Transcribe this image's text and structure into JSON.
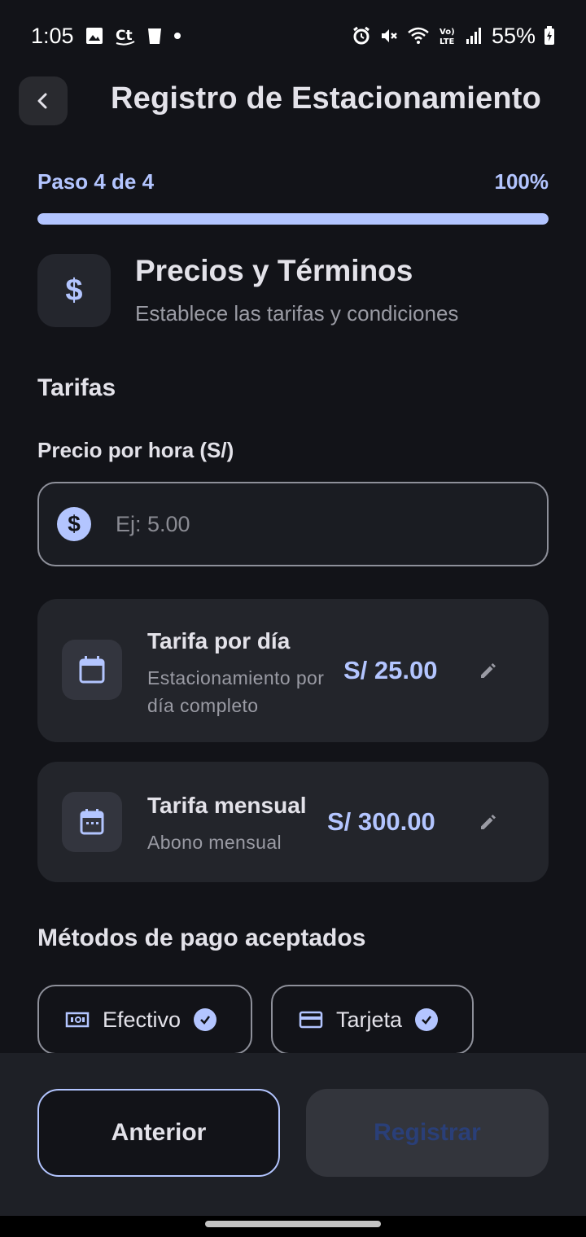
{
  "status_bar": {
    "time": "1:05",
    "battery": "55%",
    "left_icons": [
      "image-icon",
      "ct-icon",
      "cup-icon",
      "dot-icon"
    ],
    "right_icons": [
      "alarm-icon",
      "mute-icon",
      "wifi-icon",
      "volte-icon",
      "signal-icon",
      "battery-icon"
    ]
  },
  "header": {
    "title": "Registro de Estacionamiento"
  },
  "progress": {
    "step_label": "Paso 4 de 4",
    "percent_label": "100%",
    "fraction": 1.0
  },
  "section": {
    "icon_symbol": "$",
    "title": "Precios y Términos",
    "subtitle": "Establece las tarifas y condiciones"
  },
  "tarifas": {
    "heading": "Tarifas",
    "hourly_label": "Precio por hora (S/)",
    "hourly_placeholder": "Ej: 5.00",
    "hourly_value": "",
    "dollar_symbol": "$"
  },
  "rates": [
    {
      "title": "Tarifa por día",
      "description": "Estacionamiento por día completo",
      "value": "S/ 25.00"
    },
    {
      "title": "Tarifa mensual",
      "description": "Abono mensual",
      "value": "S/ 300.00"
    }
  ],
  "payment": {
    "heading": "Métodos de pago aceptados",
    "methods": [
      {
        "label": "Efectivo",
        "selected": true
      },
      {
        "label": "Tarjeta",
        "selected": true
      }
    ]
  },
  "actions": {
    "previous_label": "Anterior",
    "submit_label": "Registrar"
  },
  "colors": {
    "accent": "#b3c5ff",
    "background": "#121318",
    "card": "#23252b"
  }
}
